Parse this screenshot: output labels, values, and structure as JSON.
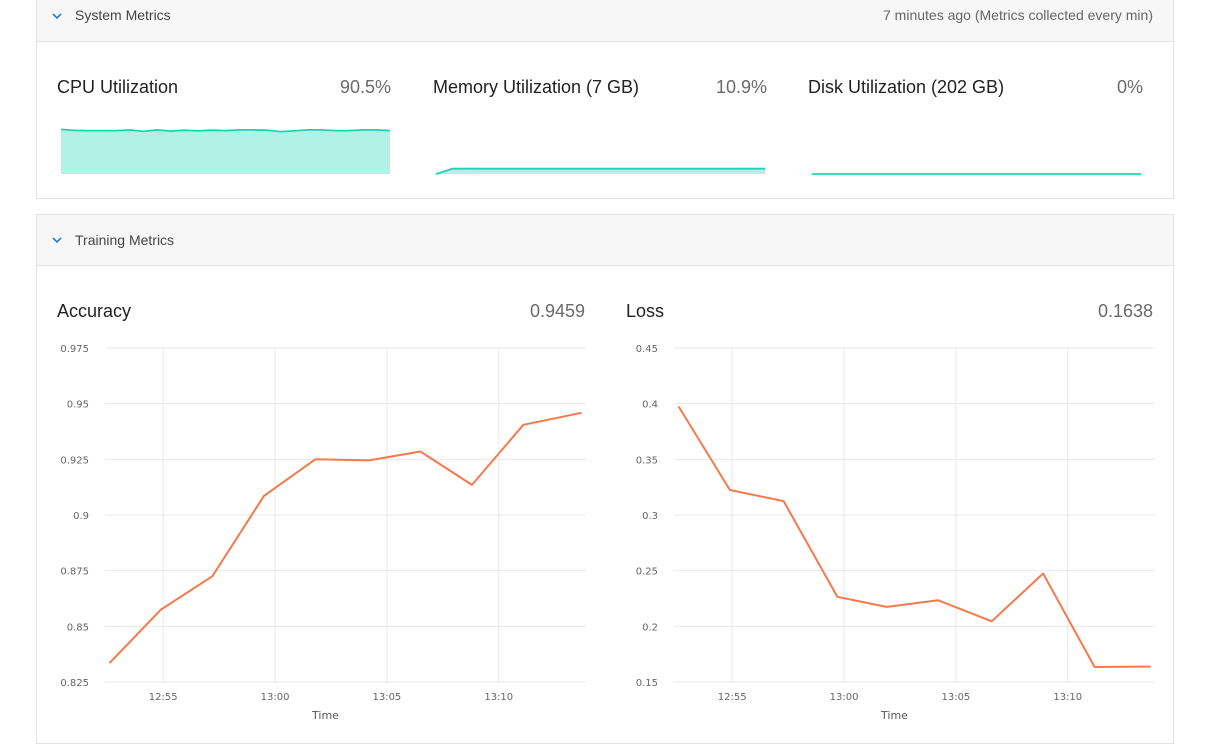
{
  "system": {
    "title": "System Metrics",
    "meta": "7 minutes ago (Metrics collected every min)",
    "cards": [
      {
        "label": "CPU Utilization",
        "value": "90.5%"
      },
      {
        "label": "Memory Utilization (7 GB)",
        "value": "10.9%"
      },
      {
        "label": "Disk Utilization (202 GB)",
        "value": "0%"
      }
    ]
  },
  "training": {
    "title": "Training Metrics",
    "charts": [
      {
        "label": "Accuracy",
        "value": "0.9459"
      },
      {
        "label": "Loss",
        "value": "0.1638"
      }
    ]
  },
  "colors": {
    "sparkline_line": "#1dd4b6",
    "sparkline_fill": "#b2f1e6",
    "series_line": "#f47a4d",
    "grid": "#e8e8e8"
  },
  "icons": {
    "collapse": "chevron-down-icon"
  },
  "chart_data": [
    {
      "type": "area",
      "title": "CPU Utilization",
      "values": [
        91,
        89,
        88.5,
        88.5,
        88.5,
        90,
        87,
        90,
        87.5,
        89.5,
        88,
        89.5,
        88.5,
        90,
        90,
        89.5,
        86.5,
        88,
        90,
        90,
        88.5,
        88.5,
        90,
        90,
        88.5
      ],
      "ylim": [
        0,
        100
      ]
    },
    {
      "type": "area",
      "title": "Memory Utilization (7 GB)",
      "values": [
        0,
        10.8,
        10.8,
        10.8,
        10.8,
        10.8,
        10.8,
        10.8,
        10.8,
        10.8,
        10.8,
        10.8,
        10.9,
        10.9,
        10.8,
        10.9,
        10.9,
        10.9,
        10.9,
        10.9,
        10.9
      ],
      "ylim": [
        0,
        100
      ]
    },
    {
      "type": "area",
      "title": "Disk Utilization (202 GB)",
      "values": [
        0,
        0,
        0,
        0,
        0,
        0,
        0,
        0,
        0,
        0,
        0
      ],
      "ylim": [
        0,
        100
      ]
    },
    {
      "type": "line",
      "title": "Accuracy",
      "xlabel": "Time",
      "x_ticks": [
        "12:55",
        "13:00",
        "13:05",
        "13:10"
      ],
      "x_tick_minutes": [
        55,
        60,
        65,
        70
      ],
      "x_range_minutes": [
        52.4,
        73.9
      ],
      "y_ticks": [
        0.825,
        0.85,
        0.875,
        0.9,
        0.925,
        0.95,
        0.975
      ],
      "ylim": [
        0.825,
        0.975
      ],
      "x_minutes": [
        52.6,
        54.9,
        57.2,
        59.5,
        61.8,
        64.2,
        66.5,
        68.8,
        71.1,
        73.7
      ],
      "values": [
        0.8335,
        0.8575,
        0.8725,
        0.9085,
        0.925,
        0.9245,
        0.9285,
        0.9135,
        0.9405,
        0.9459
      ]
    },
    {
      "type": "line",
      "title": "Loss",
      "xlabel": "Time",
      "x_ticks": [
        "12:55",
        "13:00",
        "13:05",
        "13:10"
      ],
      "x_tick_minutes": [
        55,
        60,
        65,
        70
      ],
      "x_range_minutes": [
        52.4,
        73.9
      ],
      "y_ticks": [
        0.15,
        0.2,
        0.25,
        0.3,
        0.35,
        0.4,
        0.45
      ],
      "ylim": [
        0.15,
        0.45
      ],
      "x_minutes": [
        52.6,
        54.9,
        57.3,
        59.7,
        61.9,
        64.2,
        66.6,
        68.9,
        71.2,
        73.7
      ],
      "values": [
        0.3975,
        0.3225,
        0.3125,
        0.2265,
        0.2175,
        0.2235,
        0.2045,
        0.2475,
        0.1635,
        0.1638
      ]
    }
  ]
}
